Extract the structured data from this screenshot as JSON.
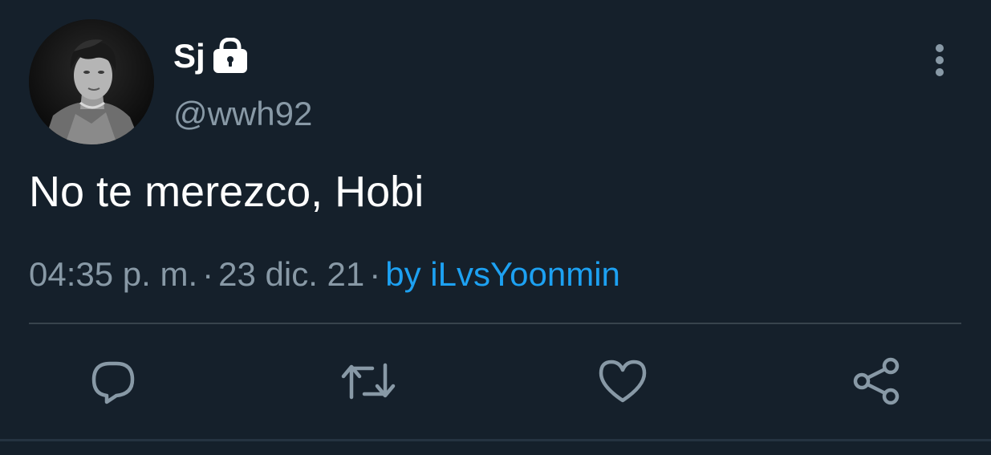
{
  "tweet": {
    "author": {
      "display_name": "Sj",
      "handle": "@wwh92",
      "protected_icon": "lock-icon",
      "avatar": "profile-photo"
    },
    "text": "No te merezco, Hobi",
    "time": "04:35 p. m.",
    "separator": "·",
    "date": "23 dic. 21",
    "source": "by iLvsYoonmin"
  },
  "actions": [
    {
      "name": "reply",
      "icon": "reply-icon"
    },
    {
      "name": "retweet",
      "icon": "retweet-icon"
    },
    {
      "name": "like",
      "icon": "heart-icon"
    },
    {
      "name": "share",
      "icon": "share-icon"
    }
  ],
  "menu_icon": "more-vertical-icon",
  "colors": {
    "background": "#15202b",
    "primary_text": "#ffffff",
    "secondary_text": "#8899a6",
    "link": "#1da1f2",
    "divider": "#38444d"
  }
}
